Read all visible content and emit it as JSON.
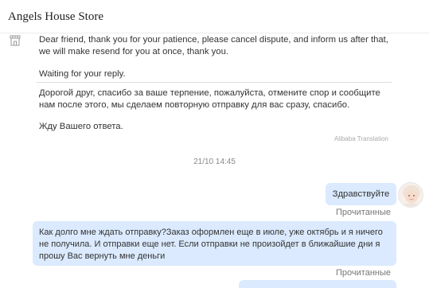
{
  "header": {
    "title": "Angels House Store"
  },
  "incoming_message": {
    "original_lines": [
      "Dear friend, thank you for your patience, please cancel dispute, and inform us after that,",
      "we will make resend for you at once, thank you."
    ],
    "original_closing": "Waiting for your reply.",
    "translated_lines": [
      "Дорогой друг, спасибо за ваше терпение, пожалуйста, отмените спор и сообщите",
      "нам после этого, мы сделаем повторную отправку для вас сразу, спасибо."
    ],
    "translated_closing": "Жду Вашего ответа.",
    "translation_note": "Alibaba Translation"
  },
  "timestamp": "21/10 14:45",
  "outgoing_messages": [
    {
      "text": "Здравствуйте",
      "status": "Прочитанные"
    },
    {
      "lines": [
        "Как долго мне ждать отправку?Заказ оформлен еще в июле, уже октябрь и я ничего",
        "не получила. И отправки еще нет. Если отправки не произойдет в ближайшие дни я",
        "прошу Вас вернуть мне деньги"
      ],
      "status": "Прочитанные"
    }
  ],
  "colors": {
    "outgoing_bubble": "#dbeafe",
    "divider": "#dcdcdc",
    "muted_text": "#777777"
  },
  "icons": {
    "store": "store-icon",
    "avatar": "user-avatar-image"
  }
}
